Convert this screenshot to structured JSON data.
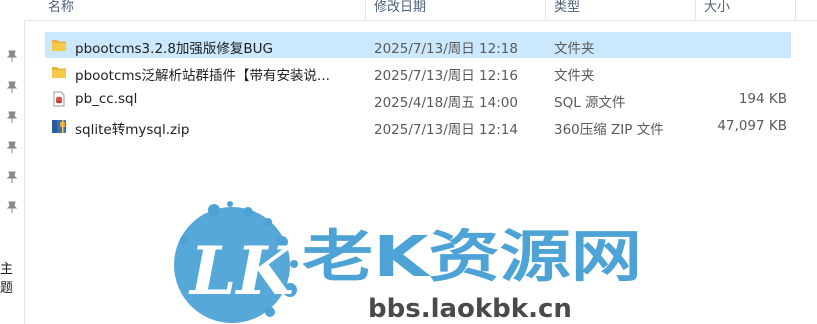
{
  "columns": {
    "name": "名称",
    "modified": "修改日期",
    "type": "类型",
    "size": "大小"
  },
  "files": [
    {
      "name": "pbootcms3.2.8加强版修复BUG",
      "modified": "2025/7/13/周日 12:18",
      "type": "文件夹",
      "size": "",
      "icon": "folder-icon",
      "selected": true
    },
    {
      "name": "pbootcms泛解析站群插件【带有安装说...",
      "modified": "2025/7/13/周日 12:16",
      "type": "文件夹",
      "size": "",
      "icon": "folder-icon",
      "selected": false
    },
    {
      "name": "pb_cc.sql",
      "modified": "2025/4/18/周五 14:00",
      "type": "SQL 源文件",
      "size": "194 KB",
      "icon": "sql-file-icon",
      "selected": false
    },
    {
      "name": "sqlite转mysql.zip",
      "modified": "2025/7/13/周日 12:14",
      "type": "360压缩 ZIP 文件",
      "size": "47,097 KB",
      "icon": "zip-archive-icon",
      "selected": false
    }
  ],
  "nav_pane": {
    "partial_label": "主题",
    "pin_icon": "pin-icon"
  },
  "watermark": {
    "logo_text": "LK",
    "title": "老K资源网",
    "url": "bbs.laokbk.cn",
    "color": "#4da3d6"
  },
  "colors": {
    "selection": "#cce8ff",
    "header_text": "#4c607a",
    "folder": "#f7c948"
  }
}
